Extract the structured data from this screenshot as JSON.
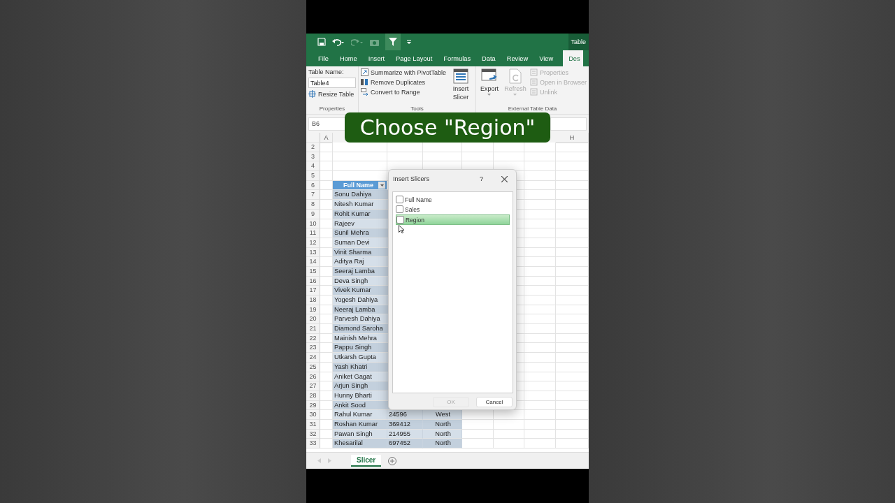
{
  "title_bar": {
    "contextual_label": "Table"
  },
  "ribbon_tabs": [
    {
      "label": "File",
      "selected": false
    },
    {
      "label": "Home",
      "selected": false
    },
    {
      "label": "Insert",
      "selected": false
    },
    {
      "label": "Page Layout",
      "selected": false
    },
    {
      "label": "Formulas",
      "selected": false
    },
    {
      "label": "Data",
      "selected": false
    },
    {
      "label": "Review",
      "selected": false
    },
    {
      "label": "View",
      "selected": false
    },
    {
      "label": "Des",
      "selected": true
    }
  ],
  "ribbon": {
    "properties": {
      "name_label": "Table Name:",
      "name_value": "Table4",
      "resize": "Resize Table",
      "group_label": "Properties"
    },
    "tools": {
      "items": [
        {
          "label": "Summarize with PivotTable",
          "kind": "pivot"
        },
        {
          "label": "Remove Duplicates",
          "kind": "duplicates"
        },
        {
          "label": "Convert to Range",
          "kind": "convert"
        }
      ],
      "slicer": "Insert Slicer",
      "group_label": "Tools"
    },
    "external": {
      "export": {
        "label": "Export",
        "disabled": false
      },
      "refresh": {
        "label": "Refresh",
        "disabled": true
      },
      "items": [
        {
          "label": "Properties",
          "disabled": true
        },
        {
          "label": "Open in Browser",
          "disabled": true
        },
        {
          "label": "Unlink",
          "disabled": true
        }
      ],
      "group_label": "External Table Data"
    }
  },
  "formula_bar": {
    "name_box": "B6"
  },
  "caption": "Choose \"Region\"",
  "column_headers": [
    "A",
    "H"
  ],
  "rows": [
    {
      "number": "2",
      "kind": "empty"
    },
    {
      "number": "3",
      "kind": "empty"
    },
    {
      "number": "4",
      "kind": "empty"
    },
    {
      "number": "5",
      "kind": "empty"
    },
    {
      "number": "6",
      "kind": "header",
      "name": "Full Name"
    },
    {
      "number": "7",
      "kind": "data",
      "name": "Sonu Dahiya"
    },
    {
      "number": "8",
      "kind": "data",
      "name": "Nitesh Kumar"
    },
    {
      "number": "9",
      "kind": "data",
      "name": "Rohit Kumar"
    },
    {
      "number": "10",
      "kind": "data",
      "name": "Rajeev"
    },
    {
      "number": "11",
      "kind": "data",
      "name": "Sunil Mehra"
    },
    {
      "number": "12",
      "kind": "data",
      "name": "Suman Devi"
    },
    {
      "number": "13",
      "kind": "data",
      "name": "Vinit Sharma"
    },
    {
      "number": "14",
      "kind": "data",
      "name": "Aditya Raj"
    },
    {
      "number": "15",
      "kind": "data",
      "name": "Seeraj Lamba"
    },
    {
      "number": "16",
      "kind": "data",
      "name": "Deva Singh"
    },
    {
      "number": "17",
      "kind": "data",
      "name": "Vivek Kumar"
    },
    {
      "number": "18",
      "kind": "data",
      "name": "Yogesh Dahiya"
    },
    {
      "number": "19",
      "kind": "data",
      "name": "Neeraj Lamba"
    },
    {
      "number": "20",
      "kind": "data",
      "name": "Parvesh Dahiya"
    },
    {
      "number": "21",
      "kind": "data",
      "name": "Diamond Saroha"
    },
    {
      "number": "22",
      "kind": "data",
      "name": "Mainish Mehra"
    },
    {
      "number": "23",
      "kind": "data",
      "name": "Pappu Singh"
    },
    {
      "number": "24",
      "kind": "data",
      "name": "Utkarsh Gupta"
    },
    {
      "number": "25",
      "kind": "data",
      "name": "Yash Khatri"
    },
    {
      "number": "26",
      "kind": "data",
      "name": "Aniket Gagat"
    },
    {
      "number": "27",
      "kind": "data",
      "name": "Arjun Singh"
    },
    {
      "number": "28",
      "kind": "data",
      "name": "Hunny Bharti"
    },
    {
      "number": "29",
      "kind": "data",
      "name": "Ankit Sood"
    },
    {
      "number": "30",
      "kind": "data",
      "name": "Rahul Kumar",
      "sales": "24596",
      "region": "West"
    },
    {
      "number": "31",
      "kind": "data",
      "name": "Roshan Kumar",
      "sales": "369412",
      "region": "North"
    },
    {
      "number": "32",
      "kind": "data",
      "name": "Pawan Singh",
      "sales": "214955",
      "region": "North"
    },
    {
      "number": "33",
      "kind": "data",
      "name": "Khesarilal",
      "sales": "697452",
      "region": "North"
    }
  ],
  "dialog": {
    "title": "Insert Slicers",
    "help": "?",
    "fields": [
      {
        "label": "Full Name",
        "checked": false,
        "hovered": false
      },
      {
        "label": "Sales",
        "checked": false,
        "hovered": false
      },
      {
        "label": "Region",
        "checked": false,
        "hovered": true
      }
    ],
    "ok": {
      "label": "OK",
      "disabled": true
    },
    "cancel": {
      "label": "Cancel",
      "disabled": false
    }
  },
  "sheet_tabs": [
    {
      "label": "Slicer",
      "selected": true
    }
  ]
}
